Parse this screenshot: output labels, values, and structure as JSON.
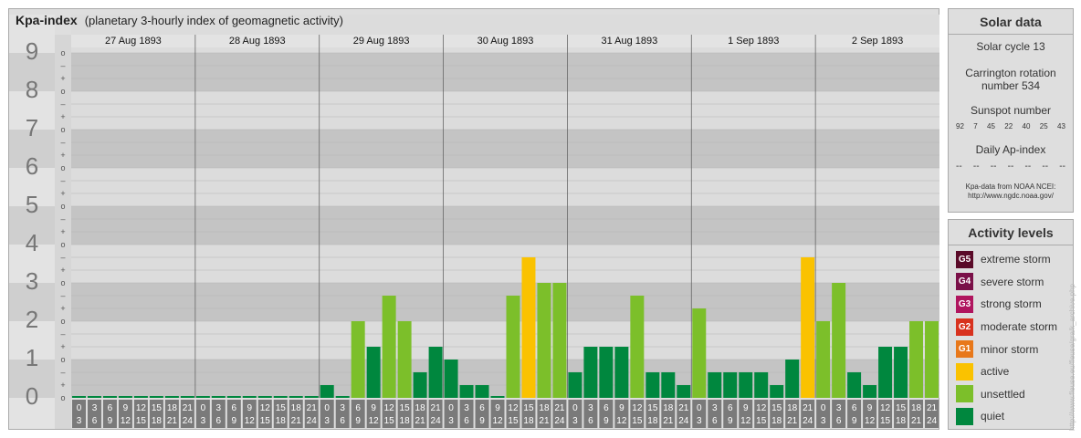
{
  "header": {
    "title": "Kpa-index",
    "subtitle": "(planetary 3-hourly index of geomagnetic activity)"
  },
  "chart_data": {
    "type": "bar",
    "title": "Kpa-index",
    "subtitle": "(planetary 3-hourly index of geomagnetic activity)",
    "days": [
      "27 Aug 1893",
      "28 Aug 1893",
      "29 Aug 1893",
      "30 Aug 1893",
      "31 Aug 1893",
      "1 Sep 1893",
      "2 Sep 1893"
    ],
    "hour_starts": [
      "0",
      "3",
      "6",
      "9",
      "12",
      "15",
      "18",
      "21"
    ],
    "hour_ends": [
      "3",
      "6",
      "9",
      "12",
      "15",
      "18",
      "21",
      "24"
    ],
    "y_major_ticks": [
      "0",
      "1",
      "2",
      "3",
      "4",
      "5",
      "6",
      "7",
      "8",
      "9"
    ],
    "y_minor_ticks": [
      "o",
      "+",
      "–"
    ],
    "ylim": [
      0,
      9.33
    ],
    "values": [
      0,
      0,
      0,
      0,
      0,
      0,
      0,
      0,
      0,
      0,
      0,
      0,
      0,
      0,
      0,
      0,
      0.333,
      0,
      2,
      1.333,
      2.667,
      2,
      0.667,
      1.333,
      1,
      0.333,
      0.333,
      0,
      2.667,
      3.667,
      3,
      3,
      0.667,
      1.333,
      1.333,
      1.333,
      2.667,
      0.667,
      0.667,
      0.333,
      2.333,
      0.667,
      0.667,
      0.667,
      0.667,
      0.333,
      1,
      3.667,
      2,
      3,
      0.667,
      0.333,
      1.333,
      1.333,
      2,
      2
    ],
    "levels": [
      "quiet",
      "quiet",
      "quiet",
      "quiet",
      "quiet",
      "quiet",
      "quiet",
      "quiet",
      "quiet",
      "quiet",
      "quiet",
      "quiet",
      "quiet",
      "quiet",
      "quiet",
      "quiet",
      "quiet",
      "quiet",
      "unsettled",
      "quiet",
      "unsettled",
      "unsettled",
      "quiet",
      "quiet",
      "quiet",
      "quiet",
      "quiet",
      "quiet",
      "unsettled",
      "active",
      "unsettled",
      "unsettled",
      "quiet",
      "quiet",
      "quiet",
      "quiet",
      "unsettled",
      "quiet",
      "quiet",
      "quiet",
      "unsettled",
      "quiet",
      "quiet",
      "quiet",
      "quiet",
      "quiet",
      "quiet",
      "active",
      "unsettled",
      "unsettled",
      "quiet",
      "quiet",
      "quiet",
      "quiet",
      "unsettled",
      "unsettled"
    ],
    "colors": {
      "quiet": "#00873e",
      "unsettled": "#7cbf2a",
      "active": "#fac200"
    },
    "grid": true,
    "legend": "right"
  },
  "solar": {
    "title": "Solar data",
    "cycle": "Solar cycle 13",
    "carrington_1": "Carrington rotation",
    "carrington_2": "number 534",
    "sunspot_label": "Sunspot number",
    "sunspots": [
      "92",
      "7",
      "45",
      "22",
      "40",
      "25",
      "43"
    ],
    "ap_label": "Daily Ap-index",
    "ap_values": [
      "--",
      "--",
      "--",
      "--",
      "--",
      "--",
      "--"
    ],
    "source_1": "Kpa-data from NOAA NCEI:",
    "source_2": "http://www.ngdc.noaa.gov/"
  },
  "levels": {
    "title": "Activity levels",
    "items": [
      {
        "badge": "G5",
        "label": "extreme storm",
        "color": "#5a0a28"
      },
      {
        "badge": "G4",
        "label": "severe storm",
        "color": "#7a1048"
      },
      {
        "badge": "G3",
        "label": "strong storm",
        "color": "#b0155e"
      },
      {
        "badge": "G2",
        "label": "moderate storm",
        "color": "#d8321e"
      },
      {
        "badge": "G1",
        "label": "minor storm",
        "color": "#e8781a"
      },
      {
        "badge": "",
        "label": "active",
        "color": "#fac200"
      },
      {
        "badge": "",
        "label": "unsettled",
        "color": "#7cbf2a"
      },
      {
        "badge": "",
        "label": "quiet",
        "color": "#00873e"
      }
    ]
  },
  "watermark": "http://www.fleuse.eu/fleuse/gra/k_archive.php"
}
